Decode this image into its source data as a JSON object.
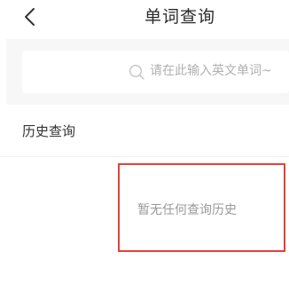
{
  "header": {
    "title": "单词查询"
  },
  "search": {
    "placeholder": "请在此输入英文单词~",
    "value": ""
  },
  "history": {
    "title": "历史查询",
    "empty_message": "暂无任何查询历史"
  },
  "icons": {
    "back": "chevron-left-icon",
    "search": "search-icon"
  },
  "colors": {
    "highlight_border": "#e5403a",
    "search_bg": "#f7f7f7",
    "placeholder": "#b0b0b0"
  }
}
